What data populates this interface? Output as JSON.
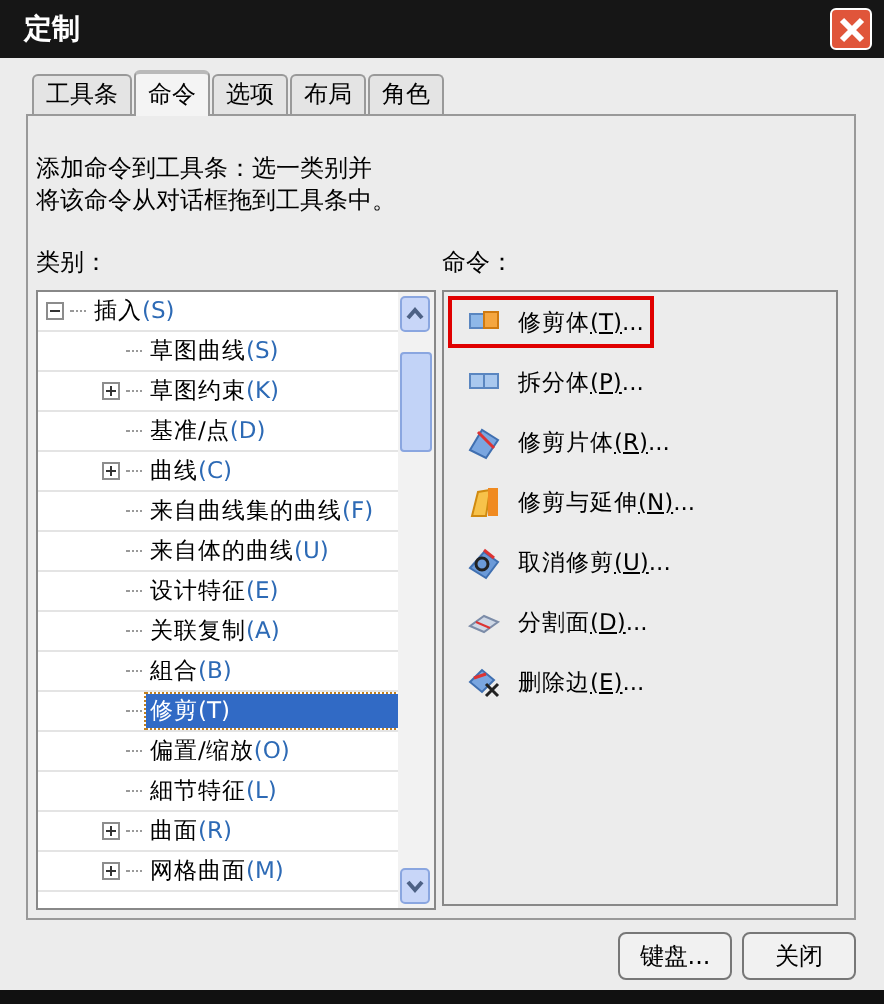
{
  "window": {
    "title": "定制"
  },
  "tabs": [
    {
      "label": "工具条",
      "selected": false
    },
    {
      "label": "命令",
      "selected": true
    },
    {
      "label": "选项",
      "selected": false
    },
    {
      "label": "布局",
      "selected": false
    },
    {
      "label": "角色",
      "selected": false
    }
  ],
  "instructions": [
    "添加命令到工具条：选一类别并",
    "将该命令从对话框拖到工具条中。"
  ],
  "categories_label": "类别：",
  "commands_label": "命令：",
  "categories": [
    {
      "label": "插入",
      "key": "(S)",
      "expanded": true,
      "selected": false,
      "children": [
        {
          "label": "草图曲线",
          "key": "(S)",
          "selected": false
        },
        {
          "label": "草图约束",
          "key": "(K)",
          "expanded": false,
          "selected": false
        },
        {
          "label": "基准/点",
          "key": "(D)",
          "selected": false
        },
        {
          "label": "曲线",
          "key": "(C)",
          "expanded": false,
          "selected": false
        },
        {
          "label": "来自曲线集的曲线",
          "key": "(F)",
          "selected": false
        },
        {
          "label": "来自体的曲线",
          "key": "(U)",
          "selected": false
        },
        {
          "label": "设计特征",
          "key": "(E)",
          "selected": false
        },
        {
          "label": "关联复制",
          "key": "(A)",
          "selected": false
        },
        {
          "label": "組合",
          "key": "(B)",
          "selected": false
        },
        {
          "label": "修剪",
          "key": "(T)",
          "selected": true
        },
        {
          "label": "偏置/缩放",
          "key": "(O)",
          "selected": false
        },
        {
          "label": "細节特征",
          "key": "(L)",
          "selected": false
        },
        {
          "label": "曲面",
          "key": "(R)",
          "expanded": false,
          "selected": false
        },
        {
          "label": "网格曲面",
          "key": "(M)",
          "expanded": false,
          "selected": false
        }
      ]
    }
  ],
  "commands": [
    {
      "label": "修剪体",
      "key": "(T)",
      "tail": "...",
      "kind": "trim-body",
      "highlighted": true
    },
    {
      "label": "拆分体",
      "key": "(P)",
      "tail": "...",
      "kind": "split-body",
      "highlighted": false
    },
    {
      "label": "修剪片体",
      "key": "(R)",
      "tail": "...",
      "kind": "trim-sheet",
      "highlighted": false
    },
    {
      "label": "修剪与延伸",
      "key": "(N)",
      "tail": "...",
      "kind": "trim-extend",
      "highlighted": false
    },
    {
      "label": "取消修剪",
      "key": "(U)",
      "tail": "...",
      "kind": "untrim",
      "highlighted": false
    },
    {
      "label": "分割面",
      "key": "(D)",
      "tail": "...",
      "kind": "divide-face",
      "highlighted": false
    },
    {
      "label": "删除边",
      "key": "(E)",
      "tail": "...",
      "kind": "delete-edge",
      "highlighted": false
    }
  ],
  "buttons": [
    "键盘...",
    "关闭"
  ]
}
